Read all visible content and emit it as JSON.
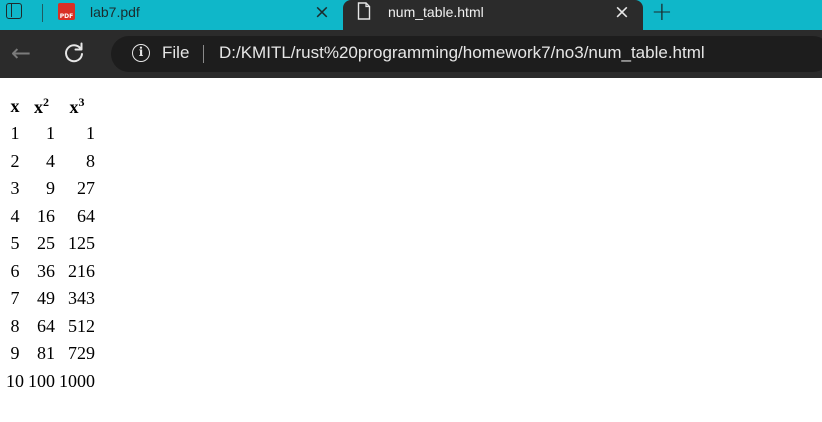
{
  "browser": {
    "tabs": [
      {
        "title": "lab7.pdf",
        "icon": "pdf-icon",
        "icon_text": "PDF",
        "active": false
      },
      {
        "title": "num_table.html",
        "icon": "document-icon",
        "active": true
      }
    ],
    "new_tab_icon": "plus-icon",
    "toolbar": {
      "back_icon": "back-arrow-icon",
      "reload_icon": "reload-icon",
      "scheme_label": "File",
      "url": "D:/KMITL/rust%20programming/homework7/no3/num_table.html"
    },
    "colors": {
      "tabstrip": "#0fb7c9",
      "toolbar": "#2b2b2b",
      "omnibox": "#1d1d1d"
    }
  },
  "table": {
    "headers": {
      "x": "x",
      "x2_base": "x",
      "x2_exp": "2",
      "x3_base": "x",
      "x3_exp": "3"
    },
    "rows": [
      [
        "1",
        "1",
        "1"
      ],
      [
        "2",
        "4",
        "8"
      ],
      [
        "3",
        "9",
        "27"
      ],
      [
        "4",
        "16",
        "64"
      ],
      [
        "5",
        "25",
        "125"
      ],
      [
        "6",
        "36",
        "216"
      ],
      [
        "7",
        "49",
        "343"
      ],
      [
        "8",
        "64",
        "512"
      ],
      [
        "9",
        "81",
        "729"
      ],
      [
        "10",
        "100",
        "1000"
      ]
    ]
  }
}
